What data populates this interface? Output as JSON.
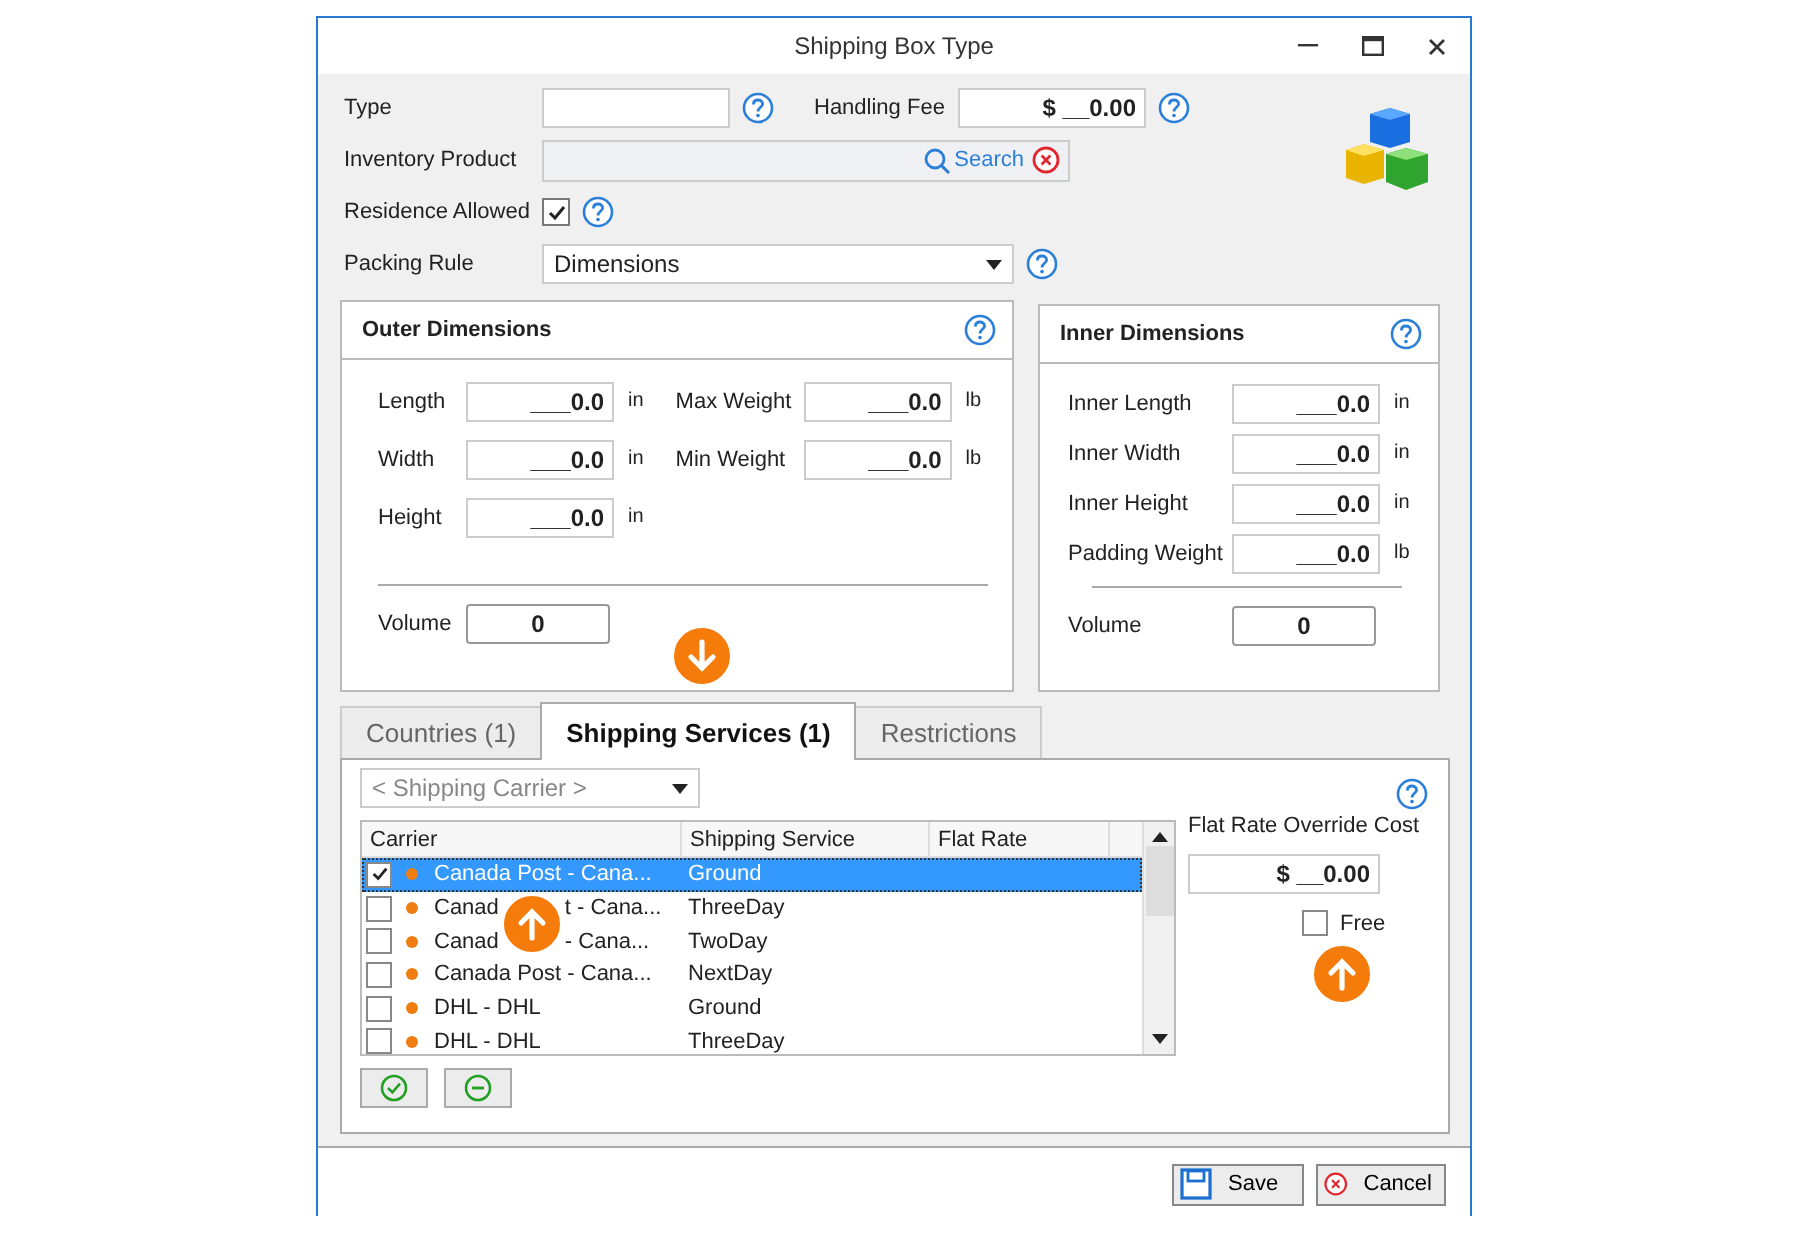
{
  "window": {
    "title": "Shipping Box Type"
  },
  "form": {
    "type": {
      "label": "Type"
    },
    "handling_fee": {
      "label": "Handling Fee",
      "value": "$ __0.00"
    },
    "inventory_product": {
      "label": "Inventory Product",
      "search_label": "Search"
    },
    "residence_allowed": {
      "label": "Residence Allowed",
      "checked": true
    },
    "packing_rule": {
      "label": "Packing Rule",
      "value": "Dimensions"
    }
  },
  "outer_dimensions": {
    "title": "Outer Dimensions",
    "left_fields": [
      {
        "label": "Length",
        "value": "___0.0",
        "unit": "in"
      },
      {
        "label": "Width",
        "value": "___0.0",
        "unit": "in"
      },
      {
        "label": "Height",
        "value": "___0.0",
        "unit": "in"
      }
    ],
    "right_fields": [
      {
        "label": "Max Weight",
        "value": "___0.0",
        "unit": "lb"
      },
      {
        "label": "Min Weight",
        "value": "___0.0",
        "unit": "lb"
      }
    ],
    "volume": {
      "label": "Volume",
      "value": "0"
    }
  },
  "inner_dimensions": {
    "title": "Inner Dimensions",
    "fields": [
      {
        "label": "Inner Length",
        "value": "___0.0",
        "unit": "in"
      },
      {
        "label": "Inner Width",
        "value": "___0.0",
        "unit": "in"
      },
      {
        "label": "Inner Height",
        "value": "___0.0",
        "unit": "in"
      },
      {
        "label": "Padding Weight",
        "value": "___0.0",
        "unit": "lb"
      }
    ],
    "volume": {
      "label": "Volume",
      "value": "0"
    }
  },
  "tabs": [
    {
      "label": "Countries (1)",
      "selected": false
    },
    {
      "label": "Shipping Services (1)",
      "selected": true
    },
    {
      "label": "Restrictions",
      "selected": false
    }
  ],
  "shipping_services": {
    "carrier_dropdown": {
      "placeholder": "< Shipping Carrier >"
    },
    "columns": [
      "Carrier",
      "Shipping Service",
      "Flat Rate"
    ],
    "rows": [
      {
        "checked": true,
        "selected": true,
        "carrier": "Canada Post - Cana...",
        "service": "Ground"
      },
      {
        "checked": false,
        "selected": false,
        "carrier_parts": [
          "Canad",
          "t - Cana..."
        ],
        "service": "ThreeDay"
      },
      {
        "checked": false,
        "selected": false,
        "carrier_parts": [
          "Canad",
          "- Cana..."
        ],
        "service": "TwoDay"
      },
      {
        "checked": false,
        "selected": false,
        "carrier": "Canada Post - Cana...",
        "service": "NextDay"
      },
      {
        "checked": false,
        "selected": false,
        "carrier": "DHL - DHL",
        "service": "Ground"
      },
      {
        "checked": false,
        "selected": false,
        "carrier": "DHL - DHL",
        "service": "ThreeDay"
      }
    ],
    "flat_rate_override": {
      "label": "Flat Rate Override Cost",
      "value": "$ __0.00"
    },
    "free": {
      "label": "Free",
      "checked": false
    }
  },
  "buttons": [
    {
      "kind": "save",
      "label": "Save"
    },
    {
      "kind": "cancel",
      "label": "Cancel"
    }
  ],
  "callouts": [
    {
      "kind": "down_arrow"
    },
    {
      "kind": "up_arrow"
    },
    {
      "kind": "up_arrow"
    }
  ]
}
